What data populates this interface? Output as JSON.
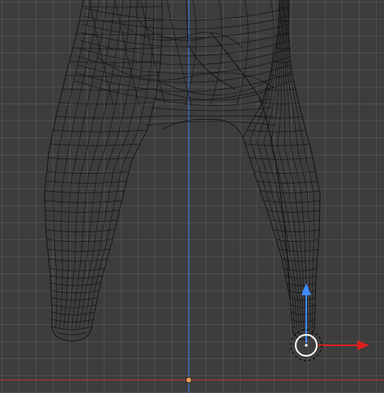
{
  "viewport": {
    "view": "front-orthographic",
    "mode": "edit",
    "shading": "wireframe",
    "mesh_object": "character-legs",
    "colors": {
      "background": "#3d3d3d",
      "grid": "#4a4a4a",
      "wire": "#111111",
      "z_axis": "#3a6fd6",
      "x_axis": "#c23a3a",
      "gizmo_y": "#3d8bff",
      "gizmo_x": "#e02020",
      "origin": "#e8a060"
    }
  },
  "transform_gizmo": {
    "type": "move",
    "axes": [
      "x-arrow",
      "z-arrow"
    ],
    "center_handle": "view-plane-circle",
    "pivot": "origin-dot"
  },
  "icons": [
    "move-gizmo-icon",
    "origin-dot-icon"
  ]
}
